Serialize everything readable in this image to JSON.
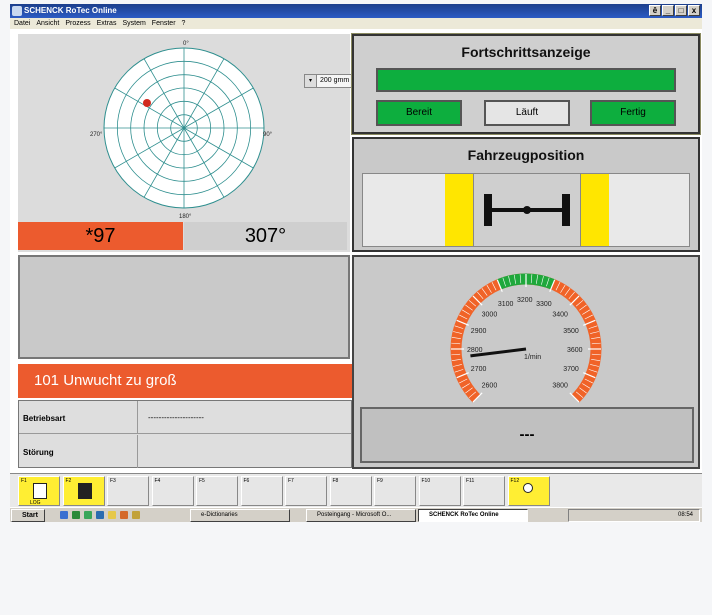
{
  "window": {
    "title": "SCHENCK RoTec Online",
    "buttons": [
      "ê",
      "_",
      "□",
      "x"
    ]
  },
  "menu": [
    "Datei",
    "Ansicht",
    "Prozess",
    "Extras",
    "System",
    "Fenster",
    "?"
  ],
  "polar": {
    "range_label": "200 gmm",
    "range_dropdown": "▾",
    "angles": {
      "top": "0°",
      "right": "90°",
      "bottom": "180°",
      "left": "270°"
    },
    "marker_color": "#d22a1f",
    "value_left": "*97",
    "value_right": "307°"
  },
  "error": {
    "message": "101  Unwucht zu groß"
  },
  "info": [
    {
      "label": "Betriebsart",
      "value": "---------------------"
    },
    {
      "label": "Störung",
      "value": ""
    }
  ],
  "progress": {
    "title": "Fortschrittsanzeige",
    "fill_fraction": 1.0,
    "buttons": [
      {
        "label": "Bereit",
        "color": "#0dae3e"
      },
      {
        "label": "Läuft",
        "color": "#e5e5e5"
      },
      {
        "label": "Fertig",
        "color": "#0dae3e"
      }
    ]
  },
  "vehicle": {
    "title": "Fahrzeugposition"
  },
  "gauge": {
    "min": 2600,
    "max": 3800,
    "value": 2600,
    "ticks": [
      "2600",
      "2700",
      "2800",
      "2900",
      "3000",
      "3100",
      "3200",
      "3300",
      "3400",
      "3500",
      "3600",
      "3700",
      "3800"
    ],
    "unit": "1/min",
    "green_range": [
      3100,
      3300
    ],
    "readout": "---"
  },
  "fkeys": [
    {
      "key": "F1",
      "sub": "LOG",
      "icon": "log-document-icon",
      "active": true
    },
    {
      "key": "F2",
      "sub": "",
      "icon": "floppy-save-icon",
      "active": true
    },
    {
      "key": "F3",
      "sub": "",
      "active": false
    },
    {
      "key": "F4",
      "sub": "",
      "active": false
    },
    {
      "key": "F5",
      "sub": "",
      "active": false
    },
    {
      "key": "F6",
      "sub": "",
      "active": false
    },
    {
      "key": "F7",
      "sub": "",
      "active": false
    },
    {
      "key": "F8",
      "sub": "",
      "active": false
    },
    {
      "key": "F9",
      "sub": "",
      "active": false
    },
    {
      "key": "F10",
      "sub": "",
      "active": false
    },
    {
      "key": "F11",
      "sub": "",
      "active": false
    },
    {
      "key": "F12",
      "sub": "",
      "icon": "magnifier-document-icon",
      "active": true
    }
  ],
  "taskbar": {
    "start": "Start",
    "items": [
      "e-Dictionaries",
      "Posteingang - Microsoft O...",
      "SCHENCK RoTec Online"
    ],
    "clock": "08:54"
  }
}
